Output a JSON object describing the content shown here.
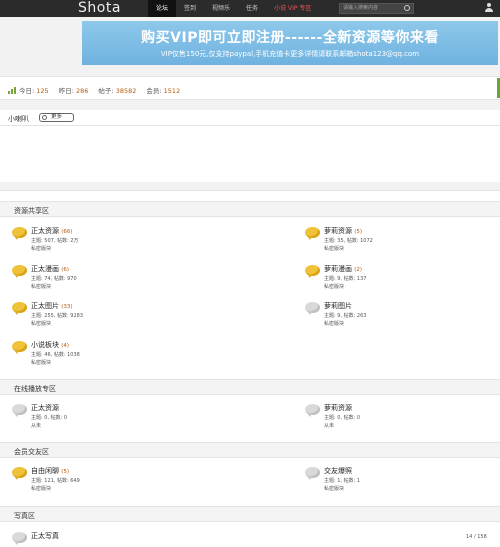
{
  "header": {
    "logo": "Shota",
    "nav": [
      {
        "label": "论坛",
        "active": true
      },
      {
        "label": "签到"
      },
      {
        "label": "视频乐"
      },
      {
        "label": "任务"
      },
      {
        "label": "小说 VIP 专区",
        "red": true
      }
    ],
    "search_placeholder": "请输入搜索内容"
  },
  "banner": {
    "title": "购买VIP即可立即注册------全新资源等你来看",
    "subtitle": "VIP仅售150元,仅支持paypal,手机充值卡更多详情请联系邮箱shota123@qq.com"
  },
  "stats": {
    "today_label": "今日:",
    "today": "125",
    "yesterday_label": "昨日:",
    "yesterday": "286",
    "posts_label": "帖子:",
    "posts": "38582",
    "members_label": "会员:",
    "members": "1512"
  },
  "shoutbox": {
    "title": "小喇叭",
    "more": "更多"
  },
  "sections": [
    {
      "title": "资源共享区",
      "boards": [
        {
          "name": "正太资源",
          "count": "(66)",
          "stats": "主题: 507, 帖数: 2万",
          "last": "私密版块",
          "icon": "gold"
        },
        {
          "name": "萝莉资源",
          "count": "(5)",
          "stats": "主题: 35, 帖数: 1072",
          "last": "私密版块",
          "icon": "gold"
        },
        {
          "name": "正太漫画",
          "count": "(6)",
          "stats": "主题: 74, 帖数: 970",
          "last": "私密版块",
          "icon": "gold"
        },
        {
          "name": "萝莉漫画",
          "count": "(2)",
          "stats": "主题: 9, 帖数: 137",
          "last": "私密版块",
          "icon": "gold"
        },
        {
          "name": "正太图片",
          "count": "(33)",
          "stats": "主题: 255, 帖数: 9283",
          "last": "私密版块",
          "icon": "gold"
        },
        {
          "name": "萝莉图片",
          "count": "",
          "stats": "主题: 9, 帖数: 263",
          "last": "私密版块",
          "icon": "gray"
        },
        {
          "name": "小说板块",
          "count": "(4)",
          "stats": "主题: 46, 帖数: 1038",
          "last": "私密版块",
          "icon": "gold"
        }
      ]
    },
    {
      "title": "在线播放专区",
      "boards": [
        {
          "name": "正太资源",
          "count": "",
          "stats": "主题: 0, 帖数: 0",
          "last": "从未",
          "icon": "gray"
        },
        {
          "name": "萝莉资源",
          "count": "",
          "stats": "主题: 0, 帖数: 0",
          "last": "从未",
          "icon": "gray"
        }
      ]
    },
    {
      "title": "会员交友区",
      "boards": [
        {
          "name": "自由闲聊",
          "count": "(5)",
          "stats": "主题: 121, 帖数: 649",
          "last": "私密版块",
          "icon": "gold"
        },
        {
          "name": "交友爆照",
          "count": "",
          "stats": "主题: 1, 帖数: 1",
          "last": "私密版块",
          "icon": "gray"
        }
      ]
    },
    {
      "title": "写真区",
      "boards": [
        {
          "name": "正太写真",
          "count": "",
          "stats": "",
          "last": "",
          "icon": "gray"
        }
      ]
    }
  ],
  "pager": "14 / 158"
}
